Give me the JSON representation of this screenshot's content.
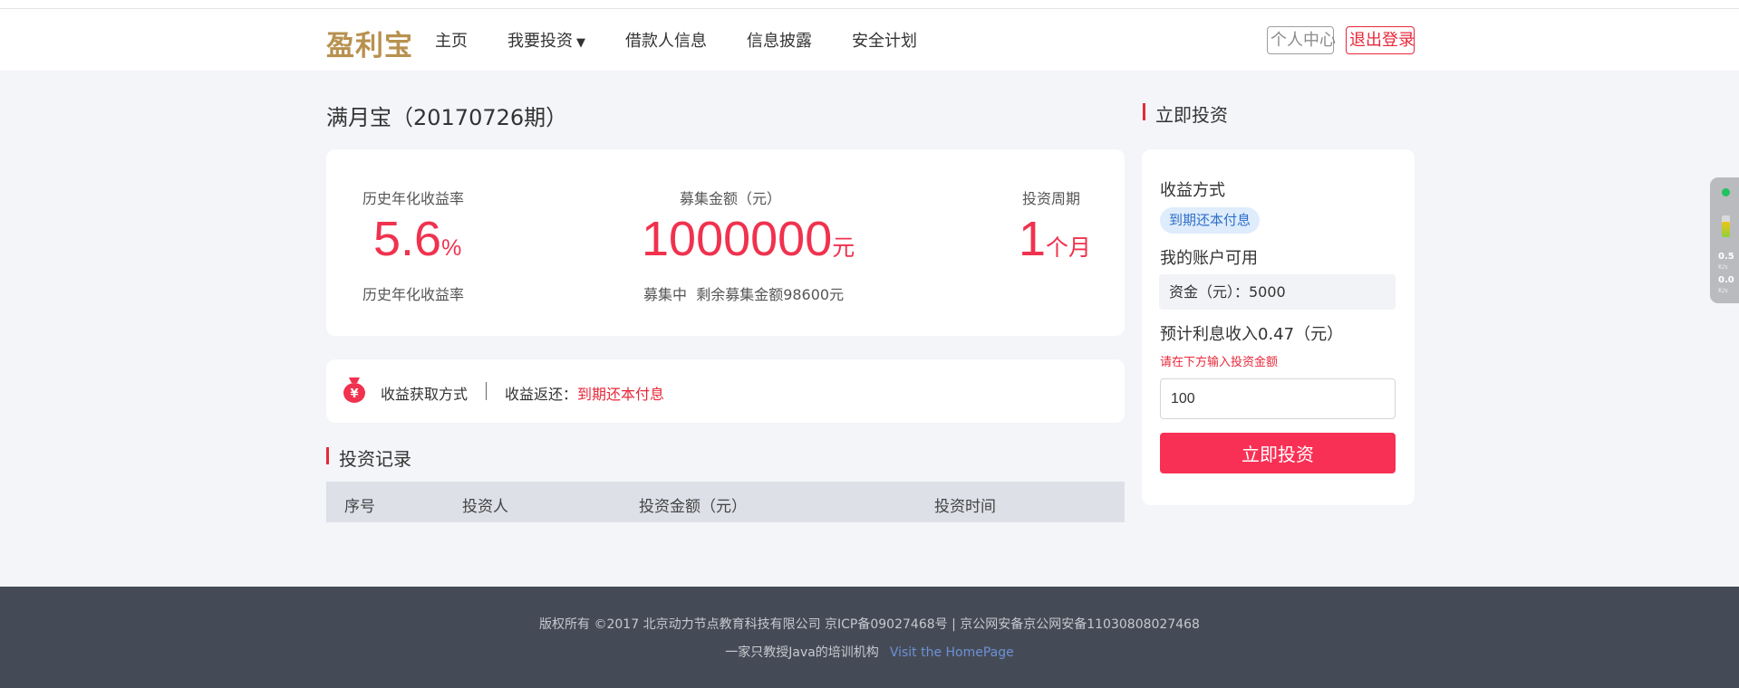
{
  "header": {
    "logo": "盈利宝",
    "nav": [
      {
        "label": "主页"
      },
      {
        "label": "我要投资",
        "has_dropdown": true,
        "caret": "▼"
      },
      {
        "label": "借款人信息"
      },
      {
        "label": "信息披露"
      },
      {
        "label": "安全计划"
      }
    ],
    "user_center": "个人中心",
    "logout": "退出登录"
  },
  "product": {
    "title": "满月宝（20170726期）",
    "rate": {
      "label_top": "历史年化收益率",
      "value": "5.6",
      "unit": "%",
      "label_bottom": "历史年化收益率"
    },
    "raise": {
      "label_top": "募集金额（元）",
      "value": "1000000",
      "unit": "元",
      "status": "募集中",
      "remaining_text": "剩余募集金额98600元"
    },
    "period": {
      "label_top": "投资周期",
      "value": "1",
      "unit": "个月"
    }
  },
  "income_info": {
    "icon": "money-bag-icon",
    "label": "收益获取方式",
    "return_label": "收益返还：",
    "return_value": "到期还本付息"
  },
  "records": {
    "title": "投资记录",
    "columns": [
      "序号",
      "投资人",
      "投资金额（元）",
      "投资时间"
    ],
    "rows": []
  },
  "sidebar": {
    "title": "立即投资",
    "income_method_label": "收益方式",
    "income_method_value": "到期还本付息",
    "account_label": "我的账户可用",
    "funds_text": "资金（元）：5000",
    "expected_interest": "预计利息收入0.47（元）",
    "hint": "请在下方输入投资金额",
    "input_value": "100",
    "button_label": "立即投资"
  },
  "footer": {
    "line1": "版权所有 ©2017 北京动力节点教育科技有限公司 京ICP备09027468号 | 京公网安备京公网安备11030808027468",
    "line2": "一家只教授Java的培训机构",
    "link": "Visit the HomePage"
  },
  "speed_widget": {
    "upload": "0.5",
    "download": "0.0",
    "unit": "K/s",
    "level": 0.7
  },
  "colors": {
    "accent_red": "#f0324e",
    "button_red": "#f93055",
    "logo_gold": "#b8914f",
    "footer_bg": "#454b56",
    "link_blue": "#6c91d6"
  }
}
